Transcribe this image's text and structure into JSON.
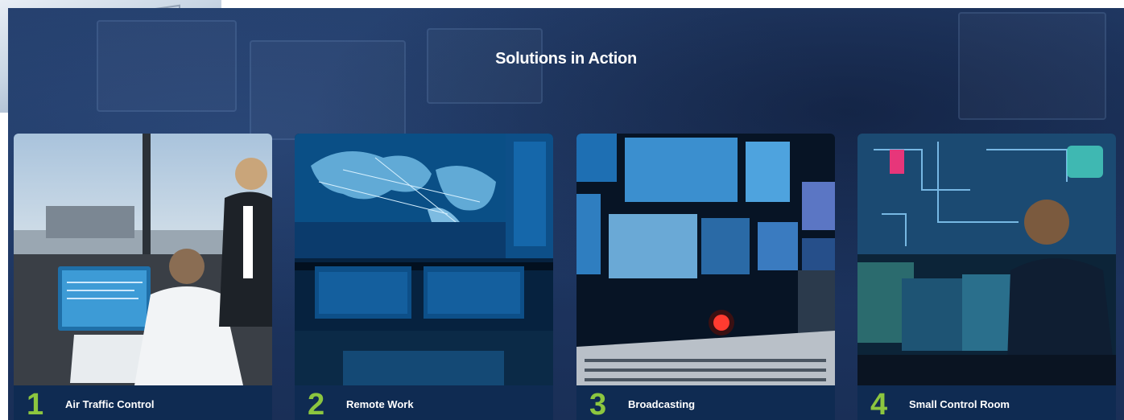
{
  "section": {
    "title": "Solutions in Action"
  },
  "cards": [
    {
      "number": "1",
      "label": "Air Traffic Control"
    },
    {
      "number": "2",
      "label": "Remote Work"
    },
    {
      "number": "3",
      "label": "Broadcasting"
    },
    {
      "number": "4",
      "label": "Small Control Room"
    }
  ],
  "colors": {
    "accent": "#8cc63f",
    "section_bg": "#1d3560",
    "card_footer": "#0f2b52"
  }
}
